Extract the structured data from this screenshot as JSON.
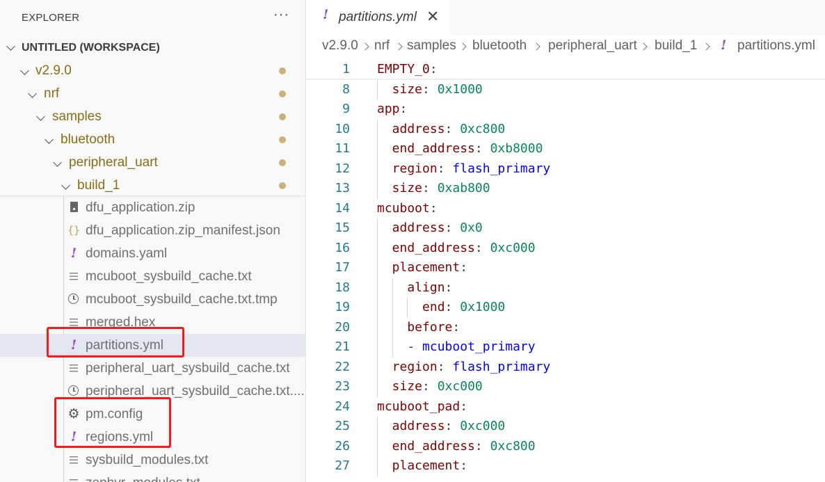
{
  "sidebar": {
    "title": "EXPLORER",
    "more_actions": "···",
    "workspace": "UNTITLED (WORKSPACE)",
    "folders": [
      {
        "label": "v2.9.0"
      },
      {
        "label": "nrf"
      },
      {
        "label": "samples"
      },
      {
        "label": "bluetooth"
      },
      {
        "label": "peripheral_uart"
      },
      {
        "label": "build_1"
      }
    ],
    "files": [
      {
        "label": "dfu_application.zip",
        "icon": "zip-file-icon"
      },
      {
        "label": "dfu_application.zip_manifest.json",
        "icon": "json-file-icon",
        "glyph": "{}"
      },
      {
        "label": "domains.yaml",
        "icon": "yaml-file-icon",
        "glyph": "!"
      },
      {
        "label": "mcuboot_sysbuild_cache.txt",
        "icon": "text-file-icon"
      },
      {
        "label": "mcuboot_sysbuild_cache.txt.tmp",
        "icon": "clock-file-icon"
      },
      {
        "label": "merged.hex",
        "icon": "text-file-icon"
      },
      {
        "label": "partitions.yml",
        "icon": "yaml-file-icon",
        "glyph": "!"
      },
      {
        "label": "peripheral_uart_sysbuild_cache.txt",
        "icon": "text-file-icon"
      },
      {
        "label": "peripheral_uart_sysbuild_cache.txt....",
        "icon": "clock-file-icon"
      },
      {
        "label": "pm.config",
        "icon": "gear-icon",
        "glyph": "⚙"
      },
      {
        "label": "regions.yml",
        "icon": "yaml-file-icon",
        "glyph": "!"
      },
      {
        "label": "sysbuild_modules.txt",
        "icon": "text-file-icon"
      },
      {
        "label": "zephyr_modules.txt",
        "icon": "text-file-icon"
      }
    ],
    "selected_file": "partitions.yml"
  },
  "tab": {
    "label": "partitions.yml",
    "icon_glyph": "!",
    "close_glyph": "✕"
  },
  "breadcrumb": [
    "v2.9.0",
    "nrf",
    "samples",
    "bluetooth",
    "peripheral_uart",
    "build_1",
    "partitions.yml"
  ],
  "breadcrumb_icon_glyph": "!",
  "editor": {
    "lines": [
      {
        "n": "1",
        "key": "EMPTY_0",
        "colon": ":",
        "val": "",
        "vt": ""
      },
      {
        "n": "8",
        "key": "size",
        "colon": ": ",
        "val": "0x1000",
        "vt": "v"
      },
      {
        "n": "9",
        "key": "app",
        "colon": ":",
        "val": "",
        "vt": ""
      },
      {
        "n": "10",
        "key": "address",
        "colon": ": ",
        "val": "0xc800",
        "vt": "v"
      },
      {
        "n": "11",
        "key": "end_address",
        "colon": ": ",
        "val": "0xb8000",
        "vt": "v"
      },
      {
        "n": "12",
        "key": "region",
        "colon": ": ",
        "val": "flash_primary",
        "vt": "s"
      },
      {
        "n": "13",
        "key": "size",
        "colon": ": ",
        "val": "0xab800",
        "vt": "v"
      },
      {
        "n": "14",
        "key": "mcuboot",
        "colon": ":",
        "val": "",
        "vt": ""
      },
      {
        "n": "15",
        "key": "address",
        "colon": ": ",
        "val": "0x0",
        "vt": "v"
      },
      {
        "n": "16",
        "key": "end_address",
        "colon": ": ",
        "val": "0xc000",
        "vt": "v"
      },
      {
        "n": "17",
        "key": "placement",
        "colon": ":",
        "val": "",
        "vt": ""
      },
      {
        "n": "18",
        "key": "align",
        "colon": ":",
        "val": "",
        "vt": ""
      },
      {
        "n": "19",
        "key": "end",
        "colon": ": ",
        "val": "0x1000",
        "vt": "v"
      },
      {
        "n": "20",
        "key": "before",
        "colon": ":",
        "val": "",
        "vt": ""
      },
      {
        "n": "21",
        "key": "",
        "colon": "- ",
        "val": "mcuboot_primary",
        "vt": "s"
      },
      {
        "n": "22",
        "key": "region",
        "colon": ": ",
        "val": "flash_primary",
        "vt": "s"
      },
      {
        "n": "23",
        "key": "size",
        "colon": ": ",
        "val": "0xc000",
        "vt": "v"
      },
      {
        "n": "24",
        "key": "mcuboot_pad",
        "colon": ":",
        "val": "",
        "vt": ""
      },
      {
        "n": "25",
        "key": "address",
        "colon": ": ",
        "val": "0xc000",
        "vt": "v"
      },
      {
        "n": "26",
        "key": "end_address",
        "colon": ": ",
        "val": "0xc800",
        "vt": "v"
      },
      {
        "n": "27",
        "key": "placement",
        "colon": ":",
        "val": "",
        "vt": ""
      }
    ]
  },
  "colors": {
    "folder_text": "#8a6d14",
    "yaml_icon": "#8d4fbf",
    "highlight_box": "#ee1c1c",
    "selected_row": "#e4e6f1",
    "line_number": "#237893",
    "yaml_key": "#800000",
    "yaml_number": "#098658",
    "yaml_string": "#0000ff"
  }
}
